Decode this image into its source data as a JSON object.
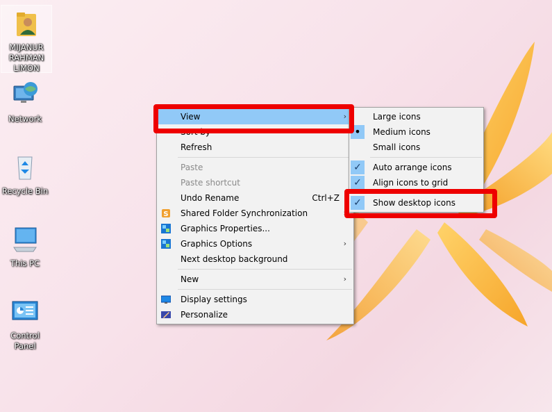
{
  "desktop": {
    "icons": [
      {
        "label": "MIJANUR RAHMAN LIMON",
        "icon": "user-folder-icon"
      },
      {
        "label": "Network",
        "icon": "network-icon"
      },
      {
        "label": "Recycle Bin",
        "icon": "recycle-bin-icon"
      },
      {
        "label": "This PC",
        "icon": "computer-icon"
      },
      {
        "label": "Control Panel",
        "icon": "control-panel-icon"
      }
    ]
  },
  "context_menu": {
    "items": [
      {
        "label": "View",
        "has_submenu": true,
        "state": "hover"
      },
      {
        "label": "Sort by",
        "has_submenu": true
      },
      {
        "label": "Refresh"
      },
      {
        "label": "Paste",
        "disabled": true
      },
      {
        "label": "Paste shortcut",
        "disabled": true
      },
      {
        "label": "Undo Rename",
        "shortcut": "Ctrl+Z"
      },
      {
        "label": "Shared Folder Synchronization",
        "has_submenu": true,
        "icon": "sync-icon"
      },
      {
        "label": "Graphics Properties...",
        "icon": "graphics-icon"
      },
      {
        "label": "Graphics Options",
        "has_submenu": true,
        "icon": "graphics-icon"
      },
      {
        "label": "Next desktop background"
      },
      {
        "label": "New",
        "has_submenu": true
      },
      {
        "label": "Display settings",
        "icon": "display-icon"
      },
      {
        "label": "Personalize",
        "icon": "personalize-icon"
      }
    ],
    "submenu_arrow": "›"
  },
  "view_submenu": {
    "items": [
      {
        "label": "Large icons"
      },
      {
        "label": "Medium icons",
        "mark": "•"
      },
      {
        "label": "Small icons"
      },
      {
        "label": "Auto arrange icons",
        "mark": "✓"
      },
      {
        "label": "Align icons to grid",
        "mark": "✓"
      },
      {
        "label": "Show desktop icons",
        "mark": "✓"
      }
    ]
  },
  "colors": {
    "highlight": "#ee0000",
    "hover": "#91c9f7",
    "menu_bg": "#f2f2f2"
  }
}
